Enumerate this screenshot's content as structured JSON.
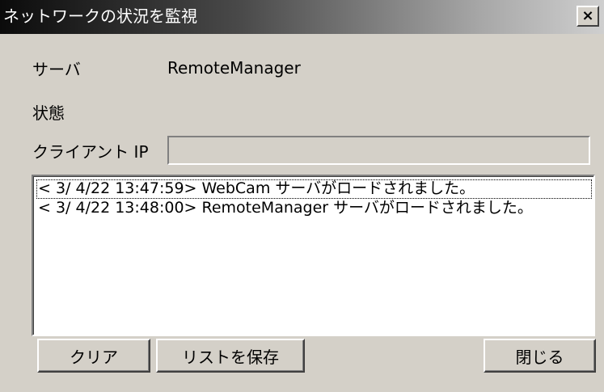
{
  "window": {
    "title": "ネットワークの状況を監視",
    "close_glyph": "×",
    "close_icon": "close-icon"
  },
  "fields": {
    "server_label": "サーバ",
    "server_value": "RemoteManager",
    "status_label": "状態",
    "status_value": "",
    "client_ip_label": "クライアント IP",
    "client_ip_value": ""
  },
  "log": {
    "items": [
      "< 3/ 4/22 13:47:59> WebCam サーバがロードされました。",
      "< 3/ 4/22 13:48:00> RemoteManager サーバがロードされました。"
    ],
    "selected_index": 0
  },
  "buttons": {
    "clear": "クリア",
    "save_list": "リストを保存",
    "close": "閉じる"
  }
}
